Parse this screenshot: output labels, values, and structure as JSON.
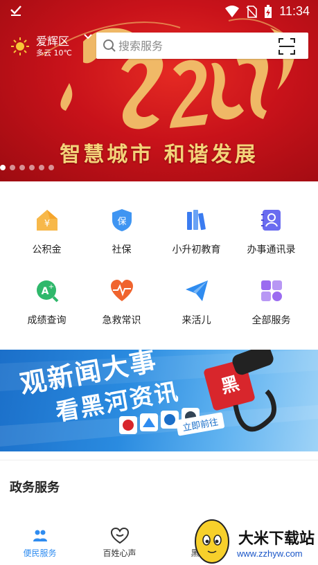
{
  "status_bar": {
    "time": "11:34"
  },
  "banner": {
    "slogan": "智慧城市  和谐发展",
    "dot_count": 6,
    "active_dot": 0
  },
  "location": {
    "district": "爱辉区",
    "weather": "多云 10℃"
  },
  "search": {
    "placeholder": "搜索服务"
  },
  "services": [
    {
      "label": "公积金",
      "icon": "housing-fund-icon",
      "color": "#f5a623"
    },
    {
      "label": "社保",
      "icon": "shield-icon",
      "color": "#2f8cf0"
    },
    {
      "label": "小升初教育",
      "icon": "books-icon",
      "color": "#3b7cf0"
    },
    {
      "label": "办事通讯录",
      "icon": "contacts-icon",
      "color": "#6a6cf0"
    },
    {
      "label": "成绩查询",
      "icon": "grade-search-icon",
      "color": "#2fb86b"
    },
    {
      "label": "急救常识",
      "icon": "heartbeat-icon",
      "color": "#f0642e"
    },
    {
      "label": "来活儿",
      "icon": "paper-plane-icon",
      "color": "#2f8cf0"
    },
    {
      "label": "全部服务",
      "icon": "grid-icon",
      "color": "#9b6cf0"
    }
  ],
  "ad": {
    "line1": "观新闻大事",
    "line2": "看黑河资讯",
    "button": "立即前往"
  },
  "section": {
    "title": "政务服务"
  },
  "tabs": [
    {
      "label": "便民服务",
      "icon": "people-icon",
      "active": true
    },
    {
      "label": "百姓心声",
      "icon": "heart-chat-icon",
      "active": false
    },
    {
      "label": "黑河",
      "icon": "news-icon",
      "active": false
    }
  ],
  "watermark": {
    "name": "大米下载站",
    "url": "www.zzhyw.com"
  },
  "colors": {
    "accent": "#2f8cf0",
    "banner_red": "#c8121a",
    "gold": "#f4d37a"
  }
}
